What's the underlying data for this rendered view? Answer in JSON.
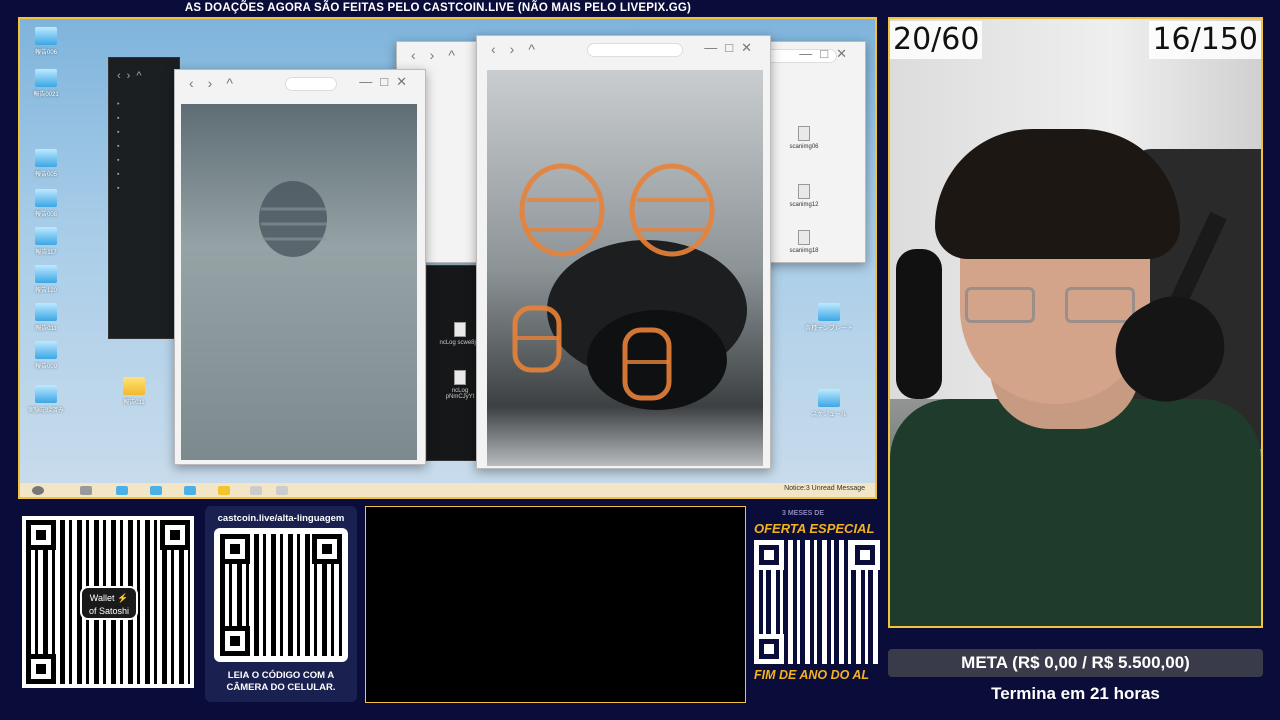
{
  "banner": {
    "text": "AS DOAÇÕES AGORA SÃO FEITAS PELO CASTCOIN.LIVE (NÃO MAIS PELO LIVEPIX.GG)"
  },
  "game": {
    "desktop_icons_left": [
      "報告006",
      "報告0021",
      "報告005",
      "報告008",
      "報告117",
      "報告120",
      "報告011",
      "報告009",
      "実験記録済み"
    ],
    "desktop_icons_right": [
      "各種テンプレート",
      "スケジュール"
    ],
    "folder_icon": "報告011",
    "back_window_files": [
      "scanimg06",
      "scanimg12",
      "scanimg18"
    ],
    "list_window_files": [
      "ncLog scwe8jJt",
      "ncLog pNmCJyYt"
    ],
    "taskbar": {
      "notice": "Notice:3 Unread Message"
    }
  },
  "webcam": {
    "counter_left": "20/60",
    "counter_right": "16/150"
  },
  "goal": {
    "label": "META (R$ 0,00 / R$ 5.500,00)",
    "ends": "Termina em 21 horas"
  },
  "wallet": {
    "label_1": "Wallet",
    "label_2": "of Satoshi"
  },
  "castcoin": {
    "url": "castcoin.live/alta-linguagem",
    "hint_1": "LEIA O CÓDIGO COM A",
    "hint_2": "CÂMERA DO CELULAR."
  },
  "offer": {
    "top": "3 MESES DE",
    "title": "OFERTA ESPECIAL",
    "bottom": "FIM DE ANO DO AL"
  },
  "colors": {
    "accent": "#f2c23a",
    "background": "#0a0d3a",
    "offer": "#f4b21f"
  }
}
